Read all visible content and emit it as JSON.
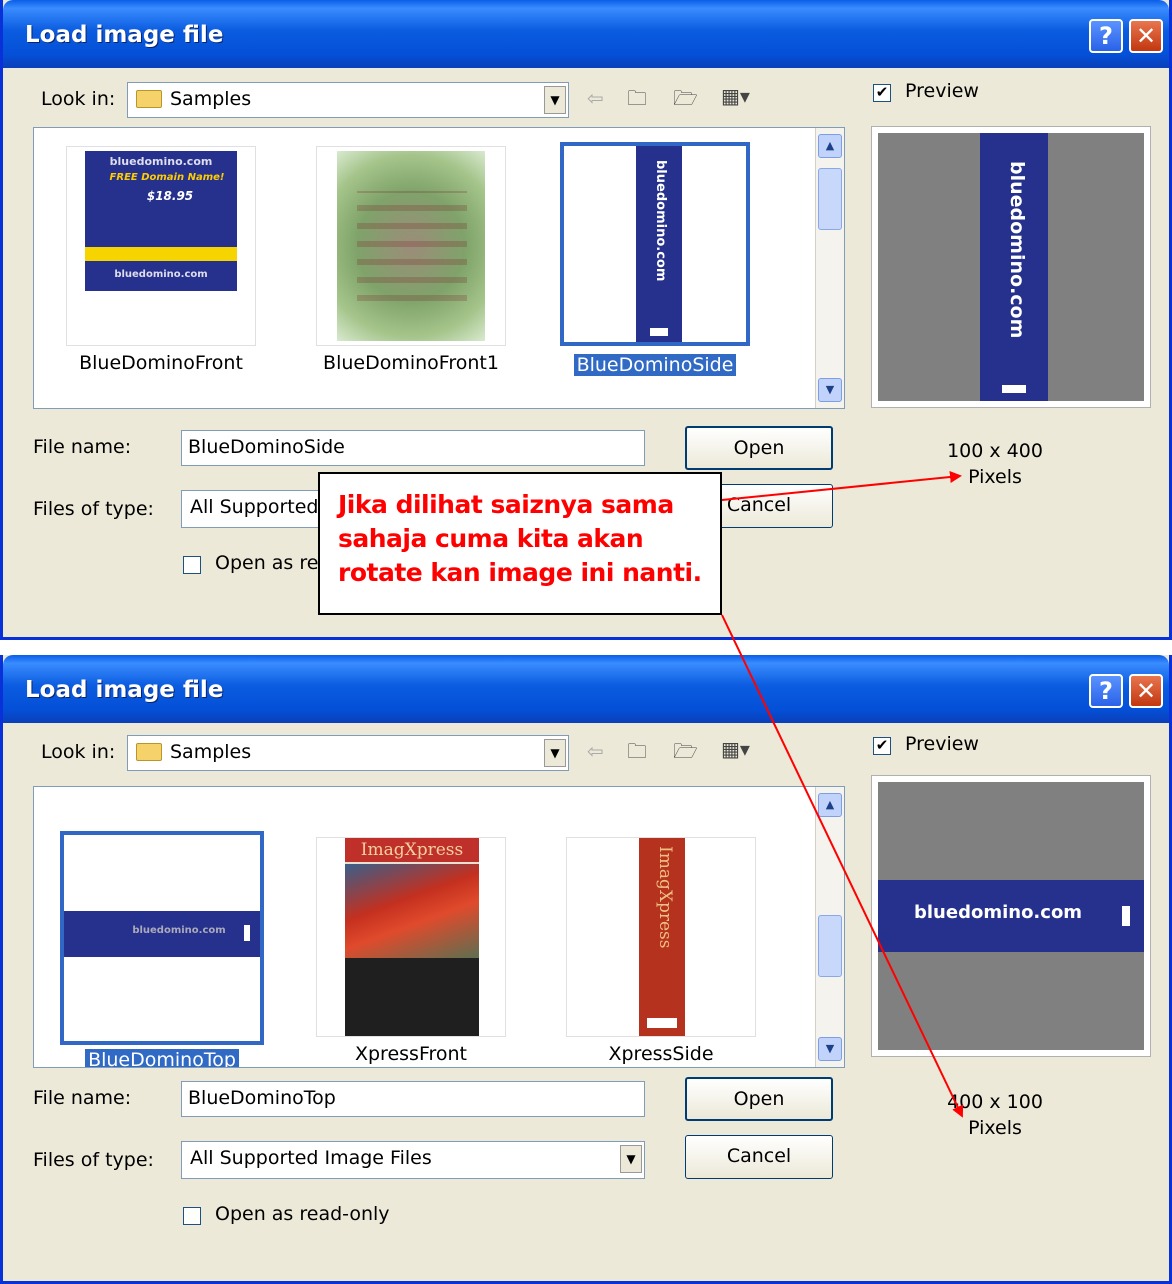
{
  "dialogs": [
    {
      "title": "Load image file",
      "look_in_label": "Look in:",
      "look_in_value": "Samples",
      "preview_label": "Preview",
      "items": [
        {
          "name": "BlueDominoFront",
          "thumb_text": "bluedomino.com",
          "thumb_price": "$18.95"
        },
        {
          "name": "BlueDominoFront1"
        },
        {
          "name": "BlueDominoSide",
          "thumb_text": "bluedomino.com"
        }
      ],
      "file_name_label": "File name:",
      "file_name_value": "BlueDominoSide",
      "files_of_type_label": "Files of type:",
      "files_of_type_value": "All Supported",
      "open_label": "Open",
      "cancel_label": "Cancel",
      "readonly_label": "Open as re",
      "preview_text": "bluedomino.com",
      "dimensions": "100 x 400",
      "units": "Pixels"
    },
    {
      "title": "Load image file",
      "look_in_label": "Look in:",
      "look_in_value": "Samples",
      "preview_label": "Preview",
      "items": [
        {
          "name": "BlueDominoTop",
          "thumb_text": "bluedomino.com"
        },
        {
          "name": "XpressFront",
          "thumb_text": "ImagXpress"
        },
        {
          "name": "XpressSide",
          "thumb_text": "ImagXpress"
        }
      ],
      "file_name_label": "File name:",
      "file_name_value": "BlueDominoTop",
      "files_of_type_label": "Files of type:",
      "files_of_type_value": "All Supported Image Files",
      "open_label": "Open",
      "cancel_label": "Cancel",
      "readonly_label": "Open as read-only",
      "preview_text": "bluedomino.com",
      "dimensions": "400 x 100",
      "units": "Pixels"
    }
  ],
  "callout": {
    "lines": [
      "Jika dilihat saiznya sama",
      "sahaja cuma kita akan",
      "rotate kan image ini nanti."
    ]
  },
  "colors": {
    "titlebar": "#0450d8",
    "dialog_bg": "#ece9d8",
    "selection": "#316ac5",
    "callout_text": "#ff0000",
    "arrow": "#ff0000"
  }
}
